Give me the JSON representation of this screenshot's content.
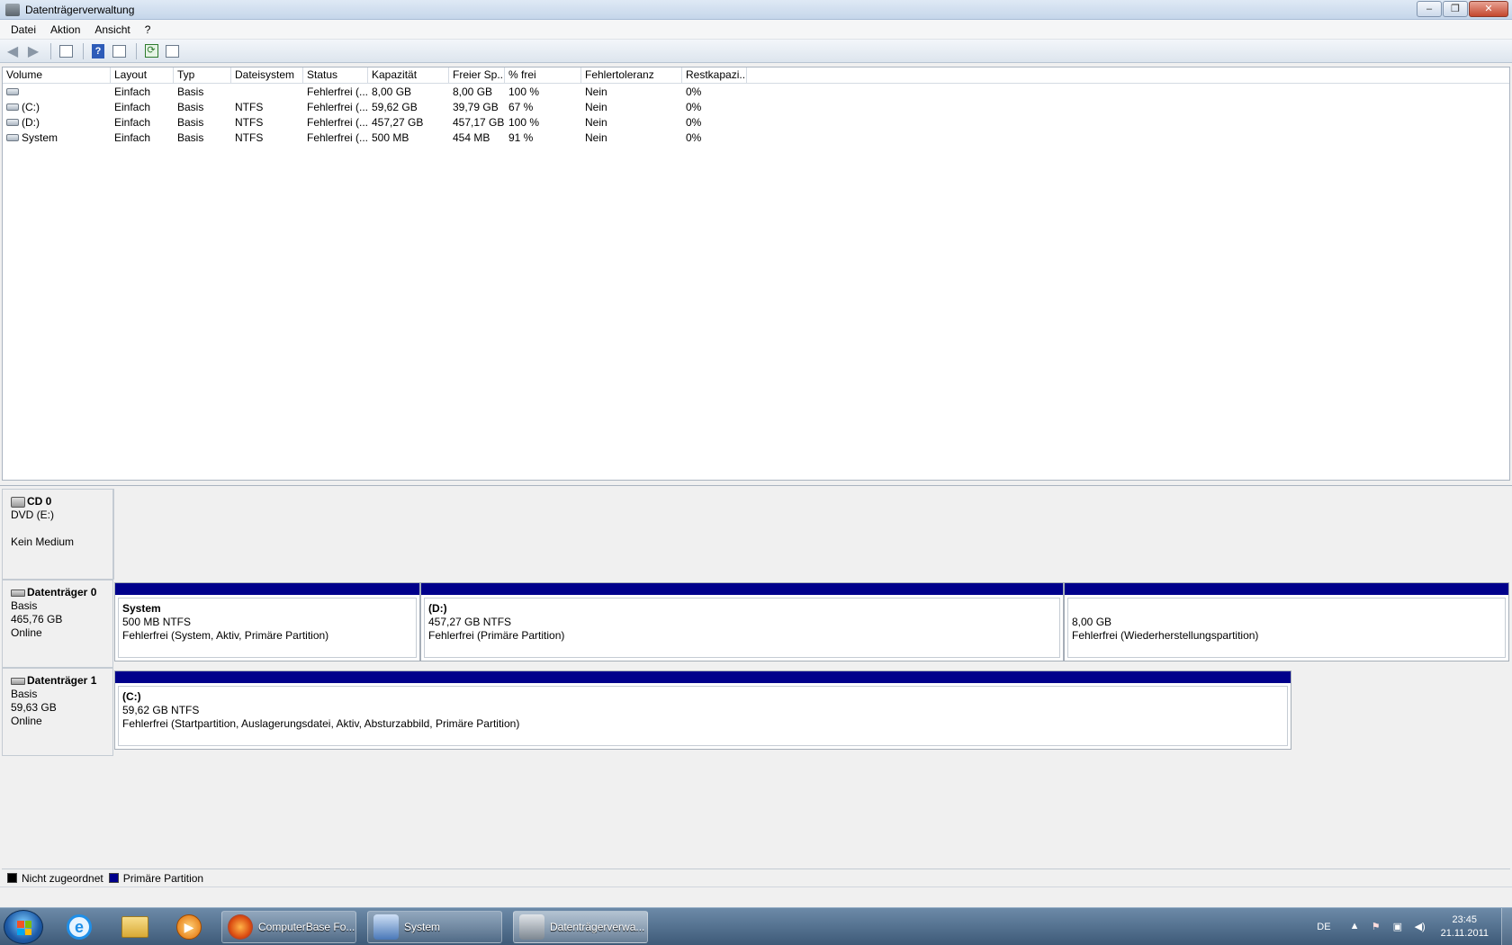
{
  "window": {
    "title": "Datenträgerverwaltung",
    "minimize": "–",
    "maximize": "❐",
    "close": "✕"
  },
  "menu": [
    "Datei",
    "Aktion",
    "Ansicht",
    "?"
  ],
  "toolbar": {
    "back": "◀",
    "forward": "▶",
    "help": "?",
    "refresh": "⟳"
  },
  "volume_table": {
    "columns": [
      "Volume",
      "Layout",
      "Typ",
      "Dateisystem",
      "Status",
      "Kapazität",
      "Freier Sp...",
      "% frei",
      "Fehlertoleranz",
      "Restkapazi..."
    ],
    "rows": [
      [
        "",
        "Einfach",
        "Basis",
        "",
        "Fehlerfrei (...",
        "8,00 GB",
        "8,00 GB",
        "100 %",
        "Nein",
        "0%"
      ],
      [
        "(C:)",
        "Einfach",
        "Basis",
        "NTFS",
        "Fehlerfrei (...",
        "59,62 GB",
        "39,79 GB",
        "67 %",
        "Nein",
        "0%"
      ],
      [
        "(D:)",
        "Einfach",
        "Basis",
        "NTFS",
        "Fehlerfrei (...",
        "457,27 GB",
        "457,17 GB",
        "100 %",
        "Nein",
        "0%"
      ],
      [
        "System",
        "Einfach",
        "Basis",
        "NTFS",
        "Fehlerfrei (...",
        "500 MB",
        "454 MB",
        "91 %",
        "Nein",
        "0%"
      ]
    ]
  },
  "disks": {
    "cd0": {
      "name": "CD 0",
      "line1": "DVD (E:)",
      "line2": "Kein Medium"
    },
    "disk0": {
      "name": "Datenträger 0",
      "type": "Basis",
      "size": "465,76 GB",
      "state": "Online",
      "partitions": [
        {
          "name": "System",
          "size": "500 MB NTFS",
          "status": "Fehlerfrei (System, Aktiv, Primäre Partition)"
        },
        {
          "name": "(D:)",
          "size": "457,27 GB NTFS",
          "status": "Fehlerfrei (Primäre Partition)"
        },
        {
          "name": "",
          "size": "8,00 GB",
          "status": "Fehlerfrei (Wiederherstellungspartition)"
        }
      ]
    },
    "disk1": {
      "name": "Datenträger 1",
      "type": "Basis",
      "size": "59,63 GB",
      "state": "Online",
      "partitions": [
        {
          "name": "(C:)",
          "size": "59,62 GB NTFS",
          "status": "Fehlerfrei (Startpartition, Auslagerungsdatei, Aktiv, Absturzabbild, Primäre Partition)"
        }
      ]
    }
  },
  "legend": {
    "unallocated": "Nicht zugeordnet",
    "primary": "Primäre Partition",
    "unallocated_color": "#000000",
    "primary_color": "#00008b"
  },
  "taskbar": {
    "tasks": [
      "ComputerBase Fo...",
      "System",
      "Datenträgerverwa..."
    ],
    "language": "DE",
    "time": "23:45",
    "date": "21.11.2011"
  }
}
